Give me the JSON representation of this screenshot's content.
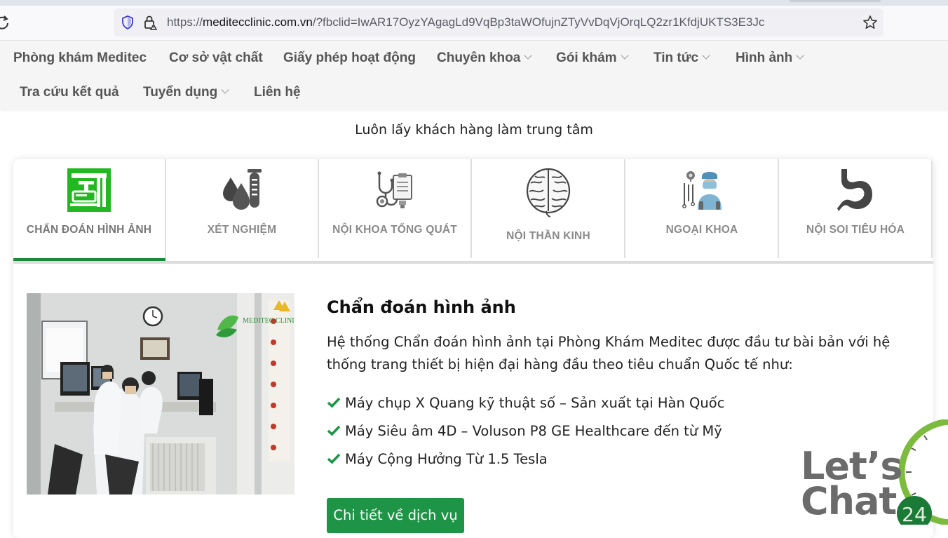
{
  "browser": {
    "url_prefix": "https://",
    "url_domain": "meditecclinic.com.vn",
    "url_rest": "/?fbclid=IwAR17OyzYAgagLd9VqBp3taWOfujnZTyVvDqVjOrqLQ2zr1KfdjUKTS3E3Jc",
    "icons": [
      "reload-icon",
      "shield-icon",
      "lock-icon",
      "bookmark-star-icon"
    ]
  },
  "nav": {
    "items": [
      {
        "label": "Phòng khám Meditec",
        "dropdown": false
      },
      {
        "label": "Cơ sở vật chất",
        "dropdown": false
      },
      {
        "label": "Giấy phép hoạt động",
        "dropdown": false
      },
      {
        "label": "Chuyên khoa",
        "dropdown": true
      },
      {
        "label": "Gói khám",
        "dropdown": true
      },
      {
        "label": "Tin tức",
        "dropdown": true
      },
      {
        "label": "Hình ảnh",
        "dropdown": true
      },
      {
        "label": "Tra cứu kết quả",
        "dropdown": false
      },
      {
        "label": "Tuyển dụng",
        "dropdown": true
      },
      {
        "label": "Liên hệ",
        "dropdown": false
      }
    ]
  },
  "tagline": "Luôn lấy khách hàng làm trung tâm",
  "tabs": [
    {
      "label": "CHẨN ĐOÁN HÌNH ẢNH",
      "icon": "imaging-machine-icon",
      "active": true
    },
    {
      "label": "XÉT NGHIỆM",
      "icon": "blood-test-icon",
      "active": false
    },
    {
      "label": "NỘI KHOA TỔNG QUÁT",
      "icon": "stethoscope-clipboard-icon",
      "active": false
    },
    {
      "label": "NỘI THẦN KINH",
      "icon": "brain-icon",
      "active": false
    },
    {
      "label": "NGOẠI KHOA",
      "icon": "surgeon-icon",
      "active": false
    },
    {
      "label": "NỘI SOI TIÊU HÓA",
      "icon": "stomach-icon",
      "active": false
    }
  ],
  "content": {
    "title": "Chẩn đoán hình ảnh",
    "description": "Hệ thống Chẩn đoán hình ảnh tại Phòng Khám Meditec được đầu tư bài bản với hệ thống trang thiết bị hiện đại hàng đầu theo tiêu chuẩn Quốc tế như:",
    "bullets": [
      "Máy chụp X Quang kỹ thuật số – Sản xuất tại Hàn Quốc",
      "Máy Siêu âm 4D – Voluson P8 GE Healthcare đến từ Mỹ",
      "Máy Cộng Hưởng Từ 1.5 Tesla"
    ],
    "button_label": "Chi tiết về dịch vụ",
    "photo_logo_text": "MEDITEC CLINIC",
    "accent_color": "#1e9447"
  },
  "chat_widget": {
    "line1": "Let’s",
    "line2": "Chat",
    "badge": "24"
  }
}
